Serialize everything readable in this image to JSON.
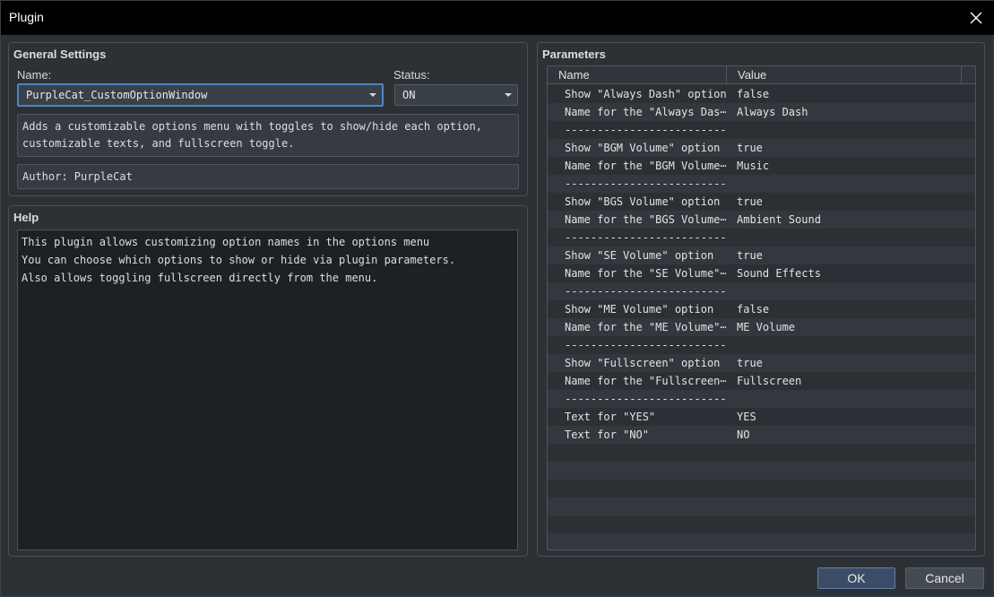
{
  "window": {
    "title": "Plugin"
  },
  "general": {
    "title": "General Settings",
    "name_label": "Name:",
    "name_value": "PurpleCat_CustomOptionWindow",
    "status_label": "Status:",
    "status_value": "ON",
    "description": "Adds a customizable options menu with toggles to show/hide each option,\ncustomizable texts, and fullscreen toggle.",
    "author": "Author: PurpleCat"
  },
  "help": {
    "title": "Help",
    "lines": [
      "This plugin allows customizing option names in the options menu",
      "You can choose which options to show or hide via plugin parameters.",
      "Also allows toggling fullscreen directly from the menu."
    ]
  },
  "parameters": {
    "title": "Parameters",
    "columns": {
      "name": "Name",
      "value": "Value"
    },
    "rows": [
      {
        "name": "Show \"Always Dash\" option",
        "value": "false"
      },
      {
        "name": "Name for the \"Always Das⋯",
        "value": "Always Dash"
      },
      {
        "name": "--------------------------",
        "value": ""
      },
      {
        "name": "Show \"BGM Volume\" option",
        "value": "true"
      },
      {
        "name": "Name for the \"BGM Volume⋯",
        "value": "Music"
      },
      {
        "name": "--------------------------",
        "value": ""
      },
      {
        "name": "Show \"BGS Volume\" option",
        "value": "true"
      },
      {
        "name": "Name for the \"BGS Volume⋯",
        "value": "Ambient Sound"
      },
      {
        "name": "--------------------------",
        "value": ""
      },
      {
        "name": "Show \"SE Volume\" option",
        "value": "true"
      },
      {
        "name": "Name for the \"SE Volume\"⋯",
        "value": "Sound Effects"
      },
      {
        "name": "--------------------------",
        "value": ""
      },
      {
        "name": "Show \"ME Volume\" option",
        "value": "false"
      },
      {
        "name": "Name for the \"ME Volume\"⋯",
        "value": "ME Volume"
      },
      {
        "name": "--------------------------",
        "value": ""
      },
      {
        "name": "Show \"Fullscreen\" option",
        "value": "true"
      },
      {
        "name": "Name for the \"Fullscreen⋯",
        "value": "Fullscreen"
      },
      {
        "name": "--------------------------",
        "value": ""
      },
      {
        "name": "Text for \"YES\"",
        "value": "YES"
      },
      {
        "name": "Text for \"NO\"",
        "value": "NO"
      }
    ],
    "empty_rows": 6
  },
  "buttons": {
    "ok": "OK",
    "cancel": "Cancel"
  }
}
